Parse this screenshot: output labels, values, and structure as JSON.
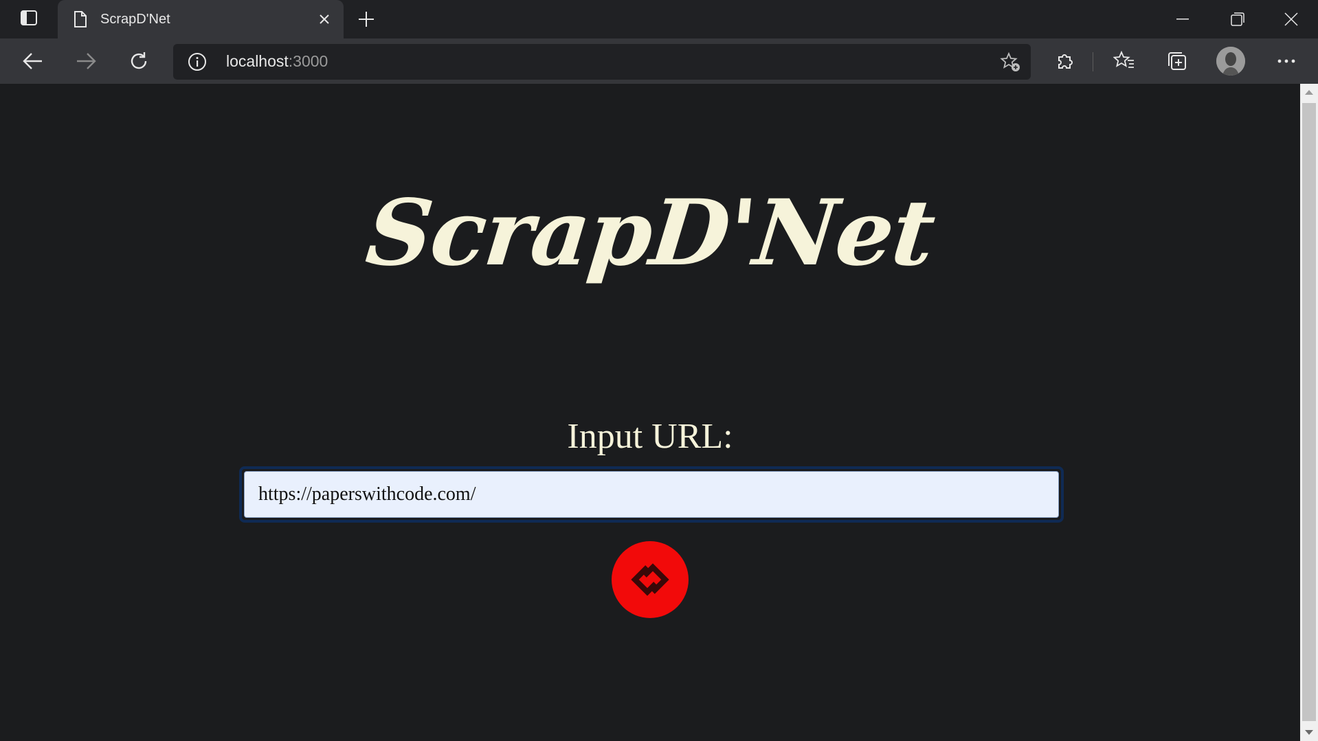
{
  "browser": {
    "tab": {
      "title": "ScrapD'Net"
    },
    "address": {
      "host": "localhost",
      "port": ":3000"
    },
    "icons": {
      "tab_actions": "tab-actions-icon",
      "page": "document-icon",
      "close": "close-icon",
      "new_tab": "plus-icon",
      "back": "back-arrow-icon",
      "forward": "forward-arrow-icon",
      "refresh": "refresh-icon",
      "site_info": "info-icon",
      "add_favorite": "star-add-icon",
      "extensions": "puzzle-icon",
      "favorites": "favorites-icon",
      "collections": "collections-icon",
      "profile": "avatar",
      "more": "more-icon"
    }
  },
  "page": {
    "title": "ScrapD'Net",
    "input_label": "Input URL:",
    "url_input_value": "https://paperswithcode.com/",
    "button_icon": "link-icon"
  },
  "colors": {
    "background": "#1b1c1e",
    "title_text": "#f6f3da",
    "button": "#f20a0a",
    "input_bg": "#e9f0fd",
    "input_border": "#0f2a54"
  }
}
